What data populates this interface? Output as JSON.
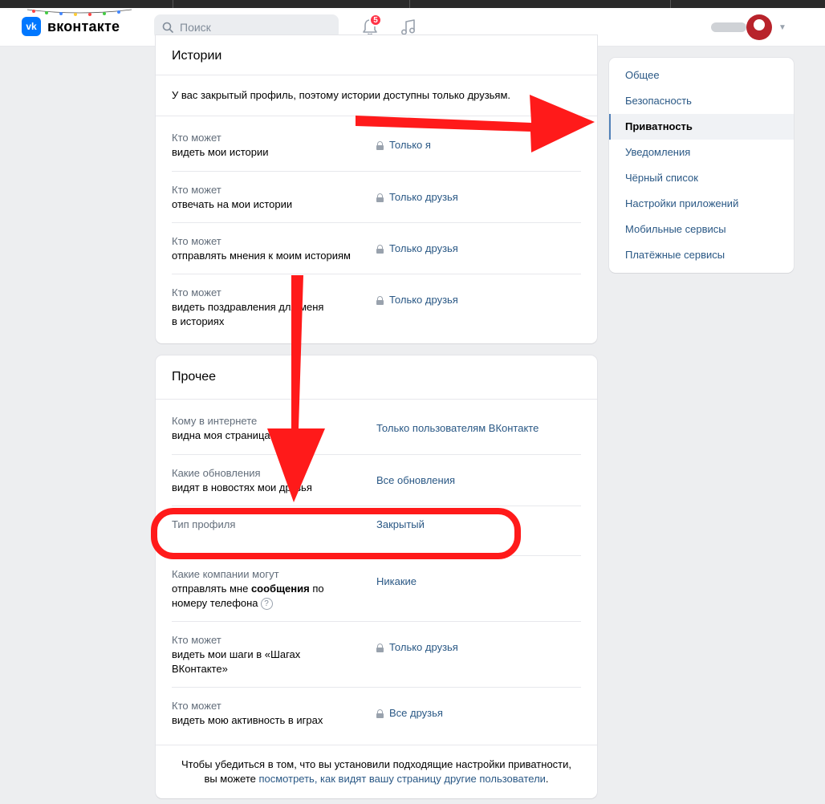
{
  "header": {
    "logo_text": "вконтакте",
    "logo_mark": "vk",
    "search_placeholder": "Поиск",
    "notifications_count": "5",
    "icons": [
      "search-icon",
      "bell-icon",
      "music-icon",
      "chevron-down-icon"
    ]
  },
  "stories": {
    "title": "Истории",
    "note": "У вас закрытый профиль, поэтому истории доступны только друзьям.",
    "rows": [
      {
        "l1": "Кто может",
        "l2": "видеть мои истории",
        "value": "Только я",
        "locked": true
      },
      {
        "l1": "Кто может",
        "l2": "отвечать на мои истории",
        "value": "Только друзья",
        "locked": true
      },
      {
        "l1": "Кто может",
        "l2": "отправлять мнения к моим историям",
        "value": "Только друзья",
        "locked": true
      },
      {
        "l1": "Кто может",
        "l2": "видеть поздравления для меня",
        "l3": "в историях",
        "value": "Только друзья",
        "locked": true
      }
    ]
  },
  "other": {
    "title": "Прочее",
    "rows": [
      {
        "l1": "Кому в интернете",
        "l2": "видна моя страница",
        "value": "Только пользователям ВКонтакте"
      },
      {
        "l1": "Какие обновления",
        "l2": "видят в новостях мои друзья",
        "value": "Все обновления"
      },
      {
        "l1": "Тип профиля",
        "value": "Закрытый"
      },
      {
        "l1": "Какие компании могут",
        "l2a": "отправлять мне ",
        "l2b": "сообщения",
        "l2c": " по",
        "l3": "номеру телефона",
        "help": "?",
        "value": "Никакие"
      },
      {
        "l1": "Кто может",
        "l2": "видеть мои шаги в «Шагах",
        "l3": "ВКонтакте»",
        "value": "Только друзья",
        "locked": true
      },
      {
        "l1": "Кто может",
        "l2": "видеть мою активность в играх",
        "value": "Все друзья",
        "locked": true
      }
    ],
    "footer_text": "Чтобы убедиться в том, что вы установили подходящие настройки приватности,",
    "footer_text2": "вы можете ",
    "footer_link": "посмотреть, как видят вашу страницу другие пользователи",
    "footer_end": "."
  },
  "menu": {
    "items": [
      "Общее",
      "Безопасность",
      "Приватность",
      "Уведомления",
      "Чёрный список",
      "Настройки приложений",
      "Мобильные сервисы",
      "Платёжные сервисы"
    ],
    "active_index": 2
  },
  "colors": {
    "accent": "#0077ff",
    "link": "#2a5885",
    "annotation_red": "#ff1a1a"
  }
}
